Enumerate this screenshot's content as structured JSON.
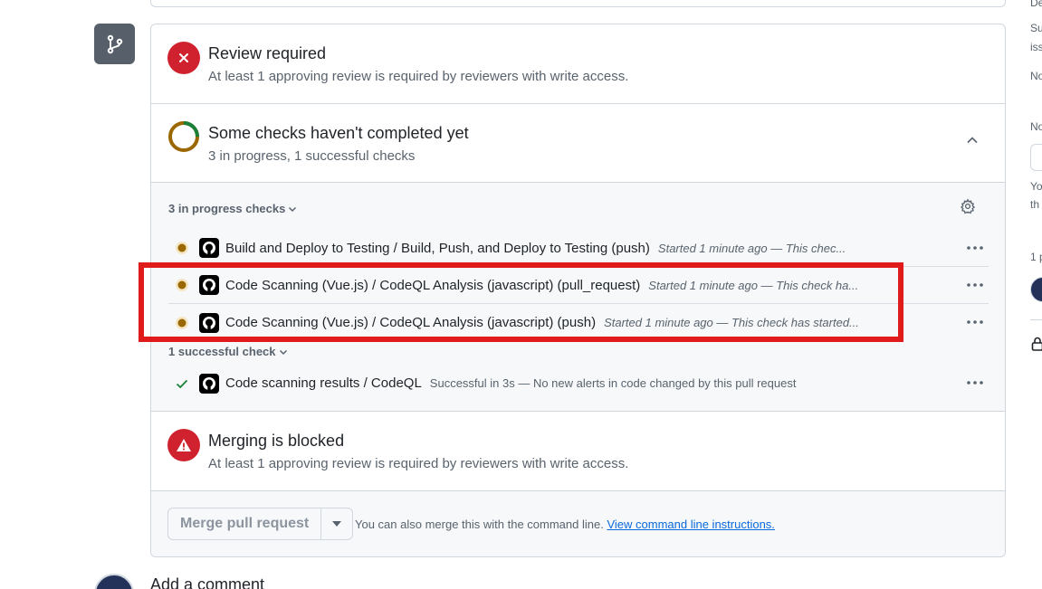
{
  "review": {
    "title": "Review required",
    "subtitle": "At least 1 approving review is required by reviewers with write access."
  },
  "checks_summary": {
    "title": "Some checks haven't completed yet",
    "subtitle": "3 in progress, 1 successful checks"
  },
  "in_progress_group": {
    "label": "3 in progress checks",
    "checks": [
      {
        "name": "Build and Deploy to Testing / Build, Push, and Deploy to Testing (push)",
        "description": "Started 1 minute ago — This chec..."
      },
      {
        "name": "Code Scanning (Vue.js) / CodeQL Analysis (javascript) (pull_request)",
        "description": "Started 1 minute ago — This check ha..."
      },
      {
        "name": "Code Scanning (Vue.js) / CodeQL Analysis (javascript) (push)",
        "description": "Started 1 minute ago — This check has started..."
      }
    ]
  },
  "successful_group": {
    "label": "1 successful check",
    "checks": [
      {
        "name": "Code scanning results / CodeQL",
        "description": "Successful in 3s — No new alerts in code changed by this pull request"
      }
    ]
  },
  "blocked": {
    "title": "Merging is blocked",
    "subtitle": "At least 1 approving review is required by reviewers with write access."
  },
  "merge": {
    "button_label": "Merge pull request",
    "hint_text": "You can also merge this with the command line.",
    "hint_link": "View command line instructions."
  },
  "comment": {
    "title": "Add a comment"
  },
  "sidebar_fragments": {
    "t1": "De",
    "t2": "Su",
    "t3": "iss",
    "t4": "No",
    "t5": "No",
    "t6": "Yo",
    "t7": "th",
    "t8": "1 p"
  },
  "colors": {
    "error_red": "#cf222e",
    "pending": "#9a6700",
    "success": "#1a7f37",
    "link": "#0969da",
    "highlight": "#e01b1b"
  },
  "icons": {
    "branch": "git-branch-icon",
    "review": "x-circle-icon",
    "pending": "dot-fill-pending-icon",
    "success": "check-icon",
    "blocked": "alert-icon"
  }
}
